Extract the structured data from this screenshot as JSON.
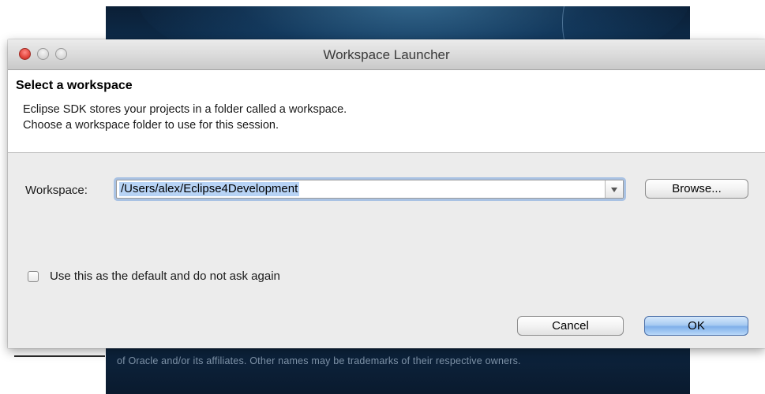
{
  "background": {
    "footer_text": "of Oracle and/or its affiliates. Other names may be trademarks of their respective owners."
  },
  "window": {
    "title": "Workspace Launcher"
  },
  "header": {
    "heading": "Select a workspace",
    "description_line1": "Eclipse SDK stores your projects in a folder called a workspace.",
    "description_line2": "Choose a workspace folder to use for this session."
  },
  "form": {
    "workspace_label": "Workspace:",
    "workspace_value": "/Users/alex/Eclipse4Development",
    "browse_label": "Browse...",
    "default_checkbox_label": "Use this as the default and do not ask again",
    "default_checked": false
  },
  "actions": {
    "cancel_label": "Cancel",
    "ok_label": "OK"
  },
  "colors": {
    "close_button": "#e2453c",
    "selection_highlight": "#b7d3f5",
    "focus_ring": "#73a0dc",
    "ok_button": "#7fb0ea"
  },
  "icons": {
    "combo_arrow": "chevron-down-icon",
    "close": "close-icon",
    "minimize": "minimize-icon",
    "maximize": "maximize-icon"
  }
}
